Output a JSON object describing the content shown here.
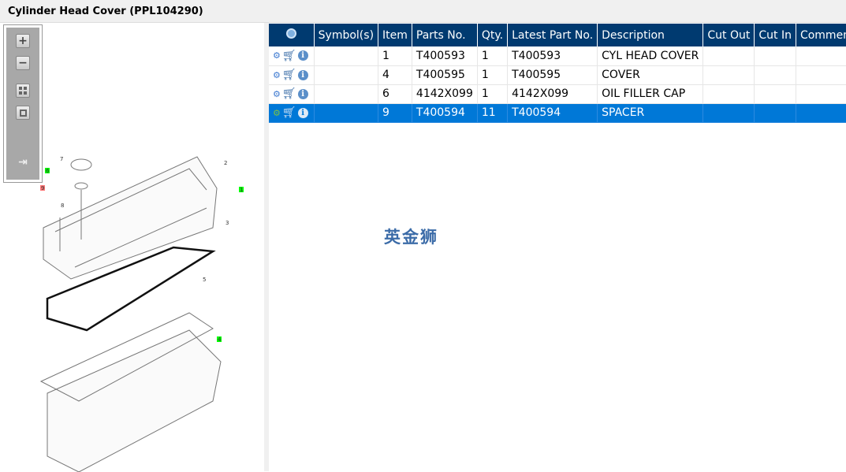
{
  "title": "Cylinder Head Cover (PPL104290)",
  "toolbar": {
    "zoom_in": "+",
    "zoom_out": "−"
  },
  "diagram": {
    "callouts": [
      "7",
      "8",
      "6",
      "9",
      "2",
      "1",
      "3",
      "5",
      "4"
    ]
  },
  "table": {
    "columns": [
      "",
      "Symbol(s)",
      "Item",
      "Parts No.",
      "Qty.",
      "Latest Part No.",
      "Description",
      "Cut Out",
      "Cut In",
      "Comment"
    ],
    "rows": [
      {
        "symbols": "",
        "item": "1",
        "parts_no": "T400593",
        "qty": "1",
        "latest": "T400593",
        "description": "CYL HEAD COVER",
        "cut_out": "",
        "cut_in": "",
        "comment": ""
      },
      {
        "symbols": "",
        "item": "4",
        "parts_no": "T400595",
        "qty": "1",
        "latest": "T400595",
        "description": "COVER",
        "cut_out": "",
        "cut_in": "",
        "comment": ""
      },
      {
        "symbols": "",
        "item": "6",
        "parts_no": "4142X099",
        "qty": "1",
        "latest": "4142X099",
        "description": "OIL FILLER CAP",
        "cut_out": "",
        "cut_in": "",
        "comment": ""
      },
      {
        "symbols": "",
        "item": "9",
        "parts_no": "T400594",
        "qty": "11",
        "latest": "T400594",
        "description": "SPACER",
        "cut_out": "",
        "cut_in": "",
        "comment": "",
        "selected": true
      }
    ]
  },
  "watermark": "英金狮",
  "colors": {
    "header": "#003a70",
    "selected": "#0078d7"
  }
}
